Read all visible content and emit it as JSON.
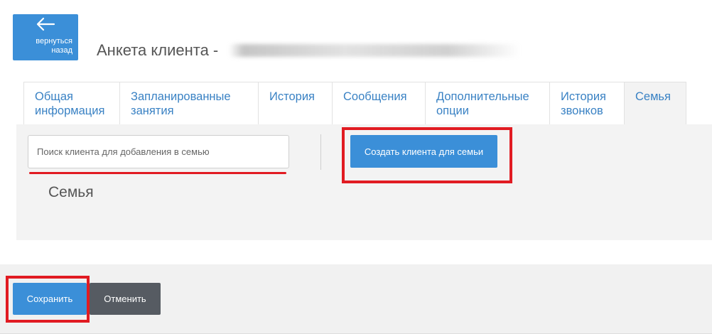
{
  "back": {
    "label": "вернуться назад",
    "icon": "arrow-left-icon"
  },
  "header": {
    "title": "Анкета клиента -"
  },
  "tabs": [
    {
      "label": "Общая информация",
      "active": false
    },
    {
      "label": "Запланированные занятия",
      "active": false
    },
    {
      "label": "История",
      "active": false
    },
    {
      "label": "Сообщения",
      "active": false
    },
    {
      "label": "Дополнительные опции",
      "active": false
    },
    {
      "label": "История звонков",
      "active": false
    },
    {
      "label": "Семья",
      "active": true
    }
  ],
  "family": {
    "search_placeholder": "Поиск клиента для добавления в семью",
    "search_value": "",
    "create_button": "Создать клиента для семьи",
    "heading": "Семья"
  },
  "footer": {
    "save_label": "Сохранить",
    "cancel_label": "Отменить"
  },
  "colors": {
    "accent": "#3b8fd8",
    "tab_text": "#3a82c4",
    "highlight": "#e11b22",
    "cancel": "#565b62",
    "panel": "#f3f3f3"
  }
}
